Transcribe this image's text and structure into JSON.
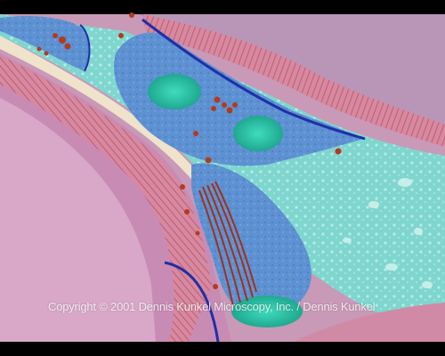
{
  "image": {
    "subject": "colorized electron micrograph",
    "palette": {
      "frame": "#000000",
      "lumen": "#7fd6cf",
      "epithelium": "#d58aa6",
      "tissue": "#c48fb5",
      "cell": "#5a8fd0",
      "nucleus": "#2ec4a8",
      "granules": "#b43a1e",
      "membrane": "#1f2fa8",
      "pale_band": "#f0e6cf"
    }
  },
  "credit": {
    "text": "Copyright © 2001 Dennis Kunkel Microscopy, Inc. / Dennis Kunkel"
  }
}
